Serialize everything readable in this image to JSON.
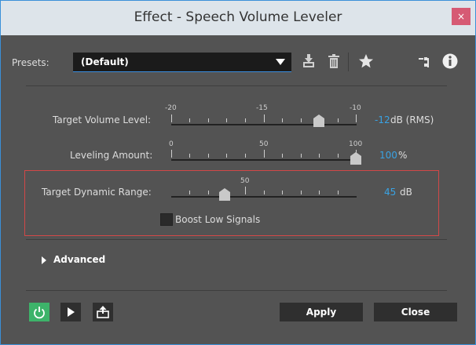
{
  "window": {
    "title": "Effect - Speech Volume Leveler",
    "close_label": "×"
  },
  "presets": {
    "label": "Presets:",
    "value": "(Default)"
  },
  "toolbar_icons": [
    "save-preset-icon",
    "delete-preset-icon",
    "favorite-star-icon",
    "routing-icon",
    "info-icon"
  ],
  "sliders": {
    "target_volume": {
      "label": "Target Volume Level:",
      "ticks": [
        "-20",
        "-15",
        "-10"
      ],
      "value": "-12",
      "unit": "dB (RMS)"
    },
    "leveling_amount": {
      "label": "Leveling Amount:",
      "ticks": [
        "0",
        "50",
        "100"
      ],
      "value": "100",
      "unit": "%"
    },
    "target_dynamic_range": {
      "label": "Target Dynamic Range:",
      "ticks": [
        "50"
      ],
      "value": "45",
      "unit": "dB"
    }
  },
  "boost": {
    "label": "Boost Low Signals",
    "checked": false
  },
  "advanced": {
    "label": "Advanced"
  },
  "buttons": {
    "apply": "Apply",
    "close": "Close"
  },
  "colors": {
    "accent_blue": "#39a3e4",
    "power_green": "#3db36a",
    "highlight_red": "#d24848",
    "title_close": "#d65a74"
  }
}
